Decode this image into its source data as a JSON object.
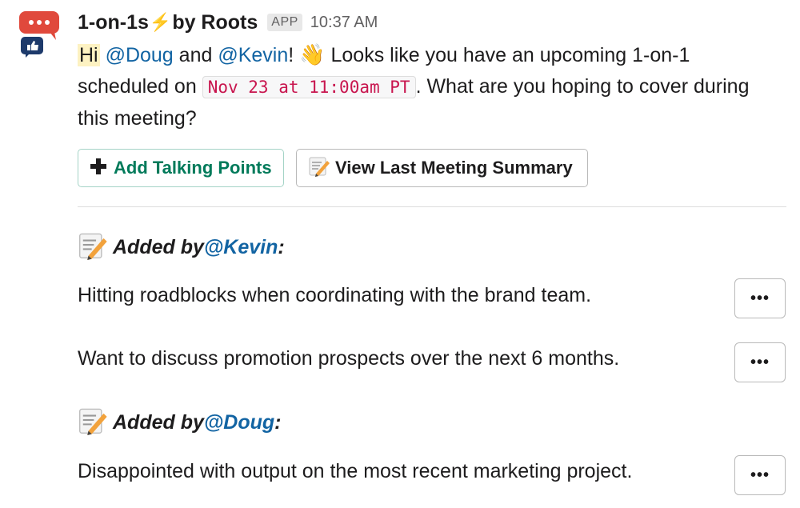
{
  "header": {
    "app_name_part1": "1-on-1s",
    "app_name_part2": "by Roots",
    "app_badge": "APP",
    "time": "10:37 AM"
  },
  "message": {
    "greeting": "Hi",
    "mention_doug": "@Doug",
    "and_text": " and ",
    "mention_kevin": "@Kevin",
    "exclaim": "! ",
    "wave_emoji": "👋",
    "text_before_date": " Looks like you have an upcoming 1-on-1 scheduled on ",
    "date_code": "Nov 23 at 11:00am PT",
    "text_after_date": ". What are you hoping to cover during this meeting?"
  },
  "buttons": {
    "add_talking_points": "Add Talking Points",
    "view_summary": "View Last Meeting Summary"
  },
  "sections": [
    {
      "added_by_label": "Added by ",
      "user": "@Kevin",
      "colon": ":",
      "items": [
        "Hitting roadblocks when coordinating with the brand team.",
        "Want to discuss promotion prospects over the next 6 months."
      ]
    },
    {
      "added_by_label": "Added by ",
      "user": "@Doug",
      "colon": ":",
      "items": [
        "Disappointed with output on the most recent marketing project."
      ]
    }
  ],
  "more_button_label": "•••",
  "colors": {
    "mention": "#1264a3",
    "primary_button_text": "#007a5a",
    "code_text": "#c8154e",
    "highlight": "#fdf2c2",
    "avatar_red": "#e01e5a",
    "avatar_navy": "#1d3a6b"
  },
  "icons": [
    "speech-bubbles-icon",
    "lightning-icon",
    "wave-emoji",
    "plus-icon",
    "memo-icon",
    "more-icon"
  ]
}
